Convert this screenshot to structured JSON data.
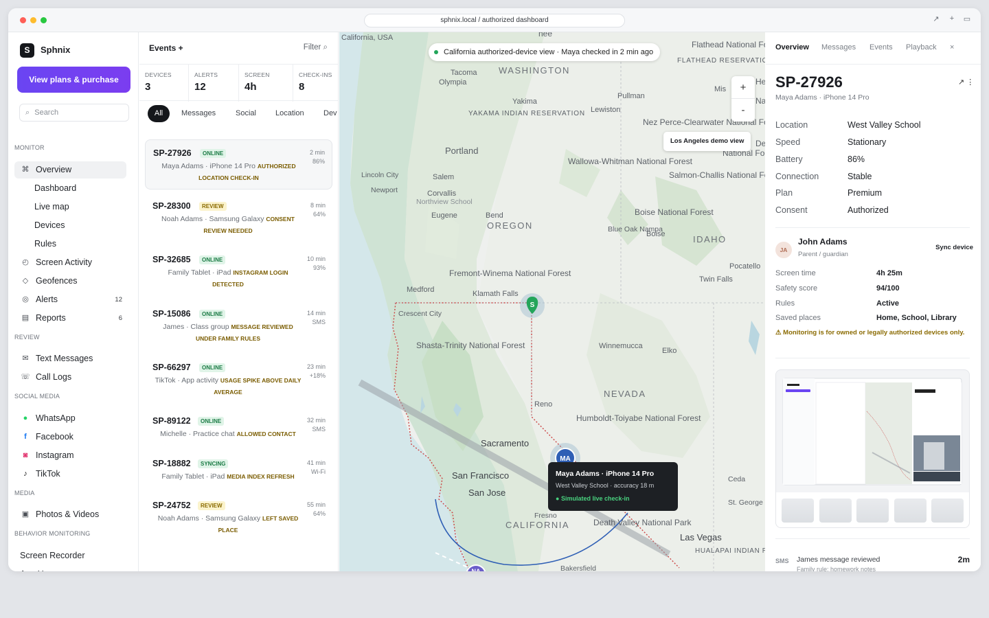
{
  "browser": {
    "url": "sphnix.local / authorized dashboard"
  },
  "colors": {
    "accent": "#6a45f2",
    "online": "#1b7b45",
    "review": "#8a6a00",
    "map_pin": "#2f5fb5"
  },
  "sidebar": {
    "logo_letter": "S",
    "app_name": "Sphnix",
    "cta": "View plans & purchase",
    "search_placeholder": "Search",
    "sections": {
      "monitor": "MONITOR",
      "review": "REVIEW",
      "social": "SOCIAL MEDIA",
      "media": "MEDIA",
      "behavior": "BEHAVIOR MONITORING"
    },
    "items": {
      "overview": "Overview",
      "dashboard": "Dashboard",
      "live_map": "Live map",
      "devices": "Devices",
      "rules": "Rules",
      "screen_activity": "Screen Activity",
      "geofences": "Geofences",
      "alerts": "Alerts",
      "alerts_count": "12",
      "reports": "Reports",
      "reports_count": "6",
      "text_messages": "Text Messages",
      "call_logs": "Call Logs",
      "whatsapp": "WhatsApp",
      "facebook": "Facebook",
      "instagram": "Instagram",
      "tiktok": "TikTok",
      "photos_videos": "Photos & Videos",
      "screen_recorder": "Screen Recorder",
      "app_usage": "App Usage"
    }
  },
  "events": {
    "title": "Events +",
    "filter": "Filter ⌕",
    "stats": [
      {
        "label": "DEVICES",
        "value": "3"
      },
      {
        "label": "ALERTS",
        "value": "12"
      },
      {
        "label": "SCREEN",
        "value": "4h"
      },
      {
        "label": "CHECK-INS",
        "value": "8"
      }
    ],
    "chips": [
      "All",
      "Messages",
      "Social",
      "Location",
      "Dev"
    ],
    "cards": [
      {
        "id": "SP-27926",
        "status": "ONLINE",
        "desc": "Maya Adams · iPhone 14 Pro",
        "tag": "AUTHORIZED LOCATION CHECK-IN",
        "time": "2 min",
        "meta": "86%"
      },
      {
        "id": "SP-28300",
        "status": "REVIEW",
        "desc": "Noah Adams · Samsung Galaxy",
        "tag": "CONSENT REVIEW NEEDED",
        "time": "8 min",
        "meta": "64%"
      },
      {
        "id": "SP-32685",
        "status": "ONLINE",
        "desc": "Family Tablet · iPad",
        "tag": "INSTAGRAM LOGIN DETECTED",
        "time": "10 min",
        "meta": "93%"
      },
      {
        "id": "SP-15086",
        "status": "ONLINE",
        "desc": "James · Class group",
        "tag": "MESSAGE REVIEWED UNDER FAMILY RULES",
        "time": "14 min",
        "meta": "SMS"
      },
      {
        "id": "SP-66297",
        "status": "ONLINE",
        "desc": "TikTok · App activity",
        "tag": "USAGE SPIKE ABOVE DAILY AVERAGE",
        "time": "23 min",
        "meta": "+18%"
      },
      {
        "id": "SP-89122",
        "status": "ONLINE",
        "desc": "Michelle · Practice chat",
        "tag": "ALLOWED CONTACT",
        "time": "32 min",
        "meta": "SMS"
      },
      {
        "id": "SP-18882",
        "status": "SYNCING",
        "desc": "Family Tablet · iPad",
        "tag": "MEDIA INDEX REFRESH",
        "time": "41 min",
        "meta": "Wi-Fi"
      },
      {
        "id": "SP-24752",
        "status": "REVIEW",
        "desc": "Noah Adams · Samsung Galaxy",
        "tag": "LEFT SAVED PLACE",
        "time": "55 min",
        "meta": "64%"
      }
    ]
  },
  "map": {
    "pill": "California authorized-device view  ·  Maya checked in 2 min ago",
    "zoom_in": "+",
    "zoom_out": "-",
    "demo_label": "Los Angeles demo view",
    "popup": {
      "title": "Maya Adams · iPhone 14 Pro",
      "sub": "West Valley School · accuracy 18 m",
      "status": "Simulated live check-in"
    },
    "pins": {
      "ma": "MA",
      "s": "S",
      "na": "NA"
    },
    "labels": {
      "top_left": "California, USA",
      "washington": "WASHINGTON",
      "oregon": "OREGON",
      "idaho": "IDAHO",
      "nevada": "NEVADA",
      "california": "CALIFORNIA",
      "tacoma": "Tacoma",
      "olympia": "Olympia",
      "yakima": "Yakima",
      "yakama": "YAKAMA INDIAN RESERVATION",
      "pullman": "Pullman",
      "lewiston": "Lewiston",
      "missoula": "Mis",
      "flathead": "Flathead National Forest",
      "flathead_res": "FLATHEAD RESERVATION",
      "nez": "Nez Perce-Clearwater National Forest",
      "portland": "Portland",
      "wallowa": "Wallowa-Whitman National Forest",
      "salmon": "Salmon-Challis National Forest",
      "lincoln": "Lincoln City",
      "salem": "Salem",
      "newport": "Newport",
      "corvallis": "Corvallis",
      "northview": "Northview School",
      "eugene": "Eugene",
      "bend": "Bend",
      "boise_nf": "Boise National Forest",
      "blue_oak": "Blue Oak Nampa",
      "boise": "Boise",
      "pocatello": "Pocatello",
      "twin_falls": "Twin Falls",
      "medford": "Medford",
      "fremont": "Fremont-Winema National Forest",
      "klamath": "Klamath Falls",
      "crescent": "Crescent City",
      "shasta": "Shasta-Trinity National Forest",
      "winnemucca": "Winnemucca",
      "elko": "Elko",
      "reno": "Reno",
      "humboldt": "Humboldt-Toiyabe National Forest",
      "sacramento": "Sacramento",
      "san_francisco": "San Francisco",
      "san_jose": "San Jose",
      "fresno": "Fresno",
      "death_valley": "Death Valley National Park",
      "las_vegas": "Las Vegas",
      "hualapai": "HUALAPAI INDIAN RESERVATION",
      "cedar": "Ceda",
      "st_george": "St. George",
      "bakersfield": "Bakersfield",
      "he": "He",
      "nat": "Nat",
      "de": "De",
      "nf": "National Fo",
      "nee": "nee"
    }
  },
  "detail": {
    "tabs": [
      "Overview",
      "Messages",
      "Events",
      "Playback",
      "×"
    ],
    "id": "SP-27926",
    "subtitle": "Maya Adams · iPhone 14 Pro",
    "icons": "↗ ⋮",
    "fields": [
      {
        "k": "Location",
        "v": "West Valley School"
      },
      {
        "k": "Speed",
        "v": "Stationary"
      },
      {
        "k": "Battery",
        "v": "86%"
      },
      {
        "k": "Connection",
        "v": "Stable"
      },
      {
        "k": "Plan",
        "v": "Premium"
      },
      {
        "k": "Consent",
        "v": "Authorized"
      }
    ],
    "guardian": {
      "initials": "JA",
      "name": "John Adams",
      "role": "Parent / guardian",
      "action": "Sync device"
    },
    "summary": [
      {
        "k": "Screen time",
        "v": "4h 25m"
      },
      {
        "k": "Safety score",
        "v": "94/100"
      },
      {
        "k": "Rules",
        "v": "Active"
      },
      {
        "k": "Saved places",
        "v": "Home, School, Library"
      }
    ],
    "warning": "⚠ Monitoring is for owned or legally authorized devices only.",
    "activity": {
      "icon": "SMS",
      "title": "James message reviewed",
      "sub": "Family rule: homework notes",
      "time": "2m"
    }
  }
}
